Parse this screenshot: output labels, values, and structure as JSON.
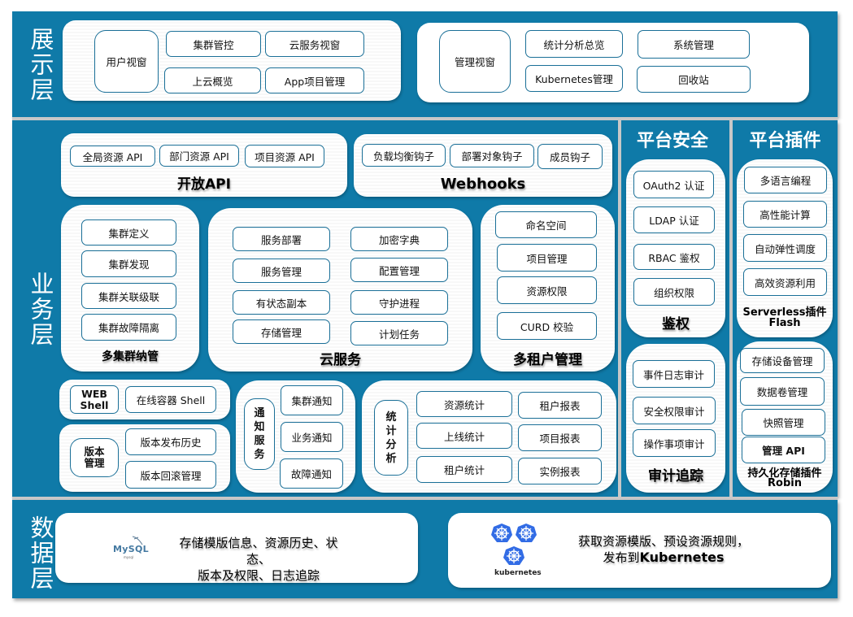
{
  "layers": {
    "presentation": "展示层",
    "business": "业务层",
    "data": "数据层"
  },
  "presentation": {
    "user_window": {
      "title": "用户视窗",
      "items": [
        "集群管控",
        "云服务视窗",
        "上云概览",
        "App项目管理"
      ]
    },
    "admin_window": {
      "title": "管理视窗",
      "items": [
        "统计分析总览",
        "系统管理",
        "Kubernetes管理",
        "回收站"
      ]
    }
  },
  "business": {
    "open_api": {
      "title": "开放API",
      "items": [
        "全局资源 API",
        "部门资源 API",
        "项目资源 API"
      ]
    },
    "webhooks": {
      "title": "Webhooks",
      "items": [
        "负载均衡钩子",
        "部署对象钩子",
        "成员钩子"
      ]
    },
    "multi_cluster": {
      "title": "多集群纳管",
      "items": [
        "集群定义",
        "集群发现",
        "集群关联级联",
        "集群故障隔离"
      ]
    },
    "cloud_service": {
      "title": "云服务",
      "left": [
        "服务部署",
        "服务管理",
        "有状态副本",
        "存储管理"
      ],
      "right": [
        "加密字典",
        "配置管理",
        "守护进程",
        "计划任务"
      ]
    },
    "multi_tenant": {
      "title": "多租户管理",
      "items": [
        "命名空间",
        "项目管理",
        "资源权限",
        "CURD 校验"
      ]
    },
    "web_shell": {
      "label": "WEB Shell",
      "label_line1": "WEB",
      "label_line2": "Shell",
      "items": [
        "在线容器 Shell"
      ]
    },
    "version": {
      "label": "版本管理",
      "label_line1": "版本",
      "label_line2": "管理",
      "items": [
        "版本发布历史",
        "版本回滚管理"
      ]
    },
    "notification": {
      "label": "通知服务",
      "label_chars": [
        "通",
        "知",
        "服",
        "务"
      ],
      "items": [
        "集群通知",
        "业务通知",
        "故障通知"
      ]
    },
    "statistics": {
      "label": "统计分析",
      "label_chars": [
        "统",
        "计",
        "分",
        "析"
      ],
      "left": [
        "资源统计",
        "上线统计",
        "租户统计"
      ],
      "right": [
        "租户报表",
        "项目报表",
        "实例报表"
      ]
    }
  },
  "security": {
    "column_title": "平台安全",
    "auth": {
      "title": "鉴权",
      "items": [
        "OAuth2 认证",
        "LDAP 认证",
        "RBAC 鉴权",
        "组织权限"
      ]
    },
    "audit": {
      "title": "审计追踪",
      "items": [
        "事件日志审计",
        "安全权限审计",
        "操作事项审计"
      ]
    }
  },
  "plugins": {
    "column_title": "平台插件",
    "serverless": {
      "title_line1": "Serverless插件",
      "title_line2": "Flash",
      "items": [
        "多语言编程",
        "高性能计算",
        "自动弹性调度",
        "高效资源利用"
      ]
    },
    "storage": {
      "title_line1": "持久化存储插件",
      "title_line2": "Robin",
      "items": [
        "存储设备管理",
        "数据卷管理",
        "快照管理",
        "管理 API"
      ]
    }
  },
  "data": {
    "mysql": {
      "logo_text": "MySQL",
      "logo_sub": "mysql",
      "line1": "存储模版信息、资源历史、状态、",
      "line2": "版本及权限、日志追踪"
    },
    "kubernetes": {
      "logo_text": "kubernetes",
      "line1": "获取资源模版、预设资源规则，",
      "line2_prefix": "发布到",
      "line2_bold": "Kubernetes"
    }
  },
  "colors": {
    "band": "#0f7aa8",
    "box_border": "#1a6f97",
    "k8s_blue": "#326ce5",
    "mysql_blue": "#4479a1",
    "mysql_orange": "#e48e00"
  }
}
